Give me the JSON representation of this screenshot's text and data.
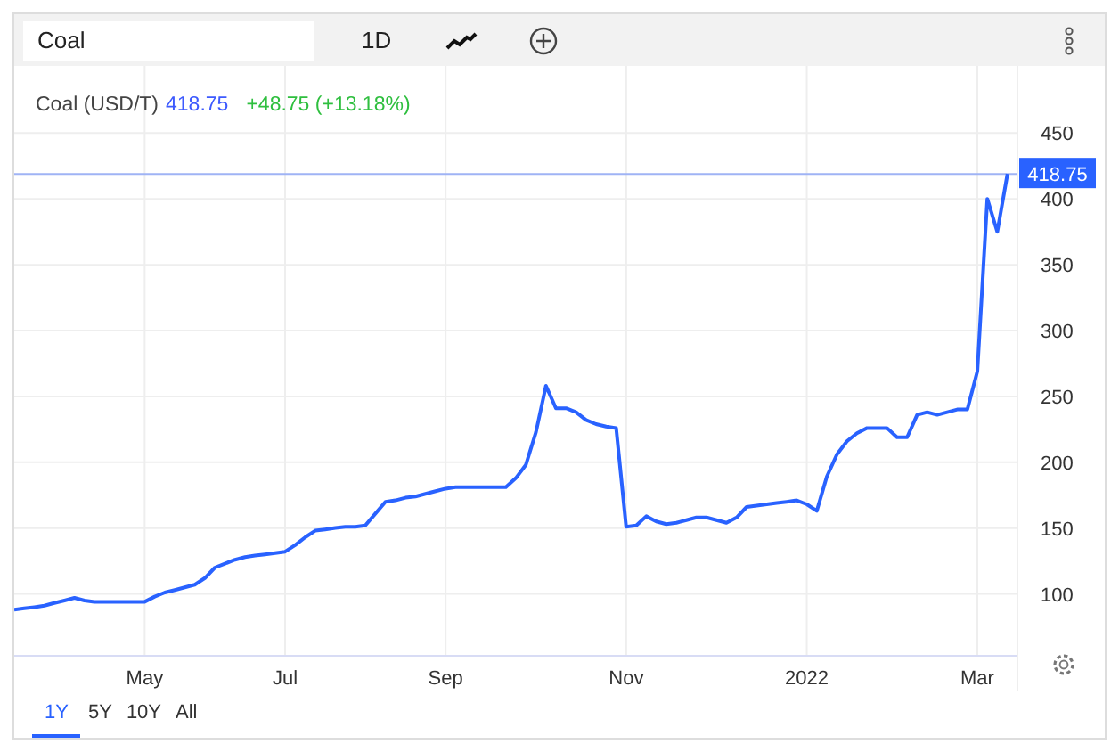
{
  "toolbar": {
    "search": {
      "value": "Coal"
    },
    "interval": "1D"
  },
  "quote": {
    "price": "418.75",
    "change": "+48.75 (+13.18%)"
  },
  "chart": {
    "price_label": "418.75",
    "chart_data": {
      "type": "line",
      "categories": [
        null,
        null,
        null,
        null,
        null,
        null,
        null,
        null,
        null,
        null,
        null,
        null,
        null,
        "May",
        null,
        null,
        null,
        null,
        null,
        null,
        null,
        null,
        null,
        null,
        null,
        null,
        null,
        "Jul",
        null,
        null,
        null,
        null,
        null,
        null,
        null,
        null,
        null,
        null,
        null,
        null,
        null,
        null,
        null,
        "Sep",
        null,
        null,
        null,
        null,
        null,
        null,
        null,
        null,
        null,
        null,
        null,
        null,
        null,
        null,
        null,
        null,
        null,
        "Nov",
        null,
        null,
        null,
        null,
        null,
        null,
        null,
        null,
        null,
        null,
        null,
        null,
        null,
        null,
        null,
        null,
        null,
        "2022",
        null,
        null,
        null,
        null,
        null,
        null,
        null,
        null,
        null,
        null,
        null,
        null,
        null,
        null,
        null,
        null,
        "Mar",
        null,
        null,
        null,
        null
      ],
      "series": [
        {
          "name": "Coal (USD/T)",
          "color": "#2962ff",
          "values": [
            88,
            89,
            90,
            91,
            93,
            95,
            97,
            95,
            94,
            94,
            94,
            94,
            94,
            94,
            98,
            101,
            103,
            105,
            107,
            112,
            120,
            123,
            126,
            128,
            129,
            130,
            131,
            132,
            137,
            143,
            148,
            149,
            150,
            151,
            151,
            152,
            161,
            170,
            171,
            173,
            174,
            176,
            178,
            180,
            181,
            181,
            181,
            181,
            181,
            181,
            188,
            198,
            223,
            258,
            241,
            241,
            238,
            232,
            229,
            227,
            226,
            151,
            152,
            159,
            155,
            153,
            154,
            156,
            158,
            158,
            156,
            154,
            158,
            166,
            167,
            168,
            169,
            170,
            171,
            168,
            163,
            189,
            206,
            216,
            222,
            226,
            226,
            226,
            219,
            219,
            236,
            238,
            236,
            238,
            240,
            240,
            269,
            400,
            375,
            419,
            null
          ]
        }
      ],
      "ylim": [
        53,
        501
      ],
      "grid": true,
      "ref_lines": [
        {
          "axis": "y",
          "value": 419,
          "color": "#9fb3f5"
        }
      ],
      "yticks": [
        100,
        150,
        200,
        250,
        300,
        350,
        400,
        450
      ]
    }
  },
  "ranges": [
    {
      "label": "1Y",
      "selected": true
    },
    {
      "label": "5Y",
      "selected": false
    },
    {
      "label": "10Y",
      "selected": false
    },
    {
      "label": "All",
      "selected": false
    }
  ]
}
